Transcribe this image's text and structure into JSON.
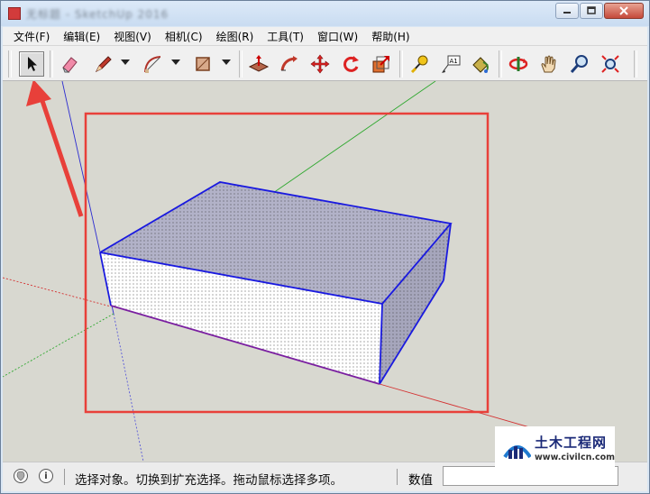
{
  "window": {
    "title_blurred": "无标题 - SketchUp 2016",
    "minimize_label": "minimize-icon",
    "maximize_label": "maximize-icon",
    "close_label": "close-icon"
  },
  "menubar": {
    "items": [
      {
        "label": "文件(F)"
      },
      {
        "label": "编辑(E)"
      },
      {
        "label": "视图(V)"
      },
      {
        "label": "相机(C)"
      },
      {
        "label": "绘图(R)"
      },
      {
        "label": "工具(T)"
      },
      {
        "label": "窗口(W)"
      },
      {
        "label": "帮助(H)"
      }
    ]
  },
  "toolbar": {
    "tools": [
      {
        "icon": "select-arrow-icon",
        "selected": true
      },
      {
        "icon": "eraser-icon"
      },
      {
        "icon": "pencil-line-icon",
        "dropdown": true
      },
      {
        "icon": "arc-icon",
        "dropdown": true
      },
      {
        "icon": "rectangle-shape-icon",
        "dropdown": true
      },
      {
        "icon": "push-pull-icon"
      },
      {
        "icon": "follow-me-icon"
      },
      {
        "icon": "move-icon"
      },
      {
        "icon": "rotate-icon"
      },
      {
        "icon": "scale-icon"
      },
      {
        "icon": "tape-measure-icon"
      },
      {
        "icon": "text-label-icon",
        "label": "A1"
      },
      {
        "icon": "paint-bucket-icon"
      },
      {
        "icon": "orbit-icon"
      },
      {
        "icon": "pan-hand-icon"
      },
      {
        "icon": "zoom-icon"
      },
      {
        "icon": "zoom-extents-icon"
      }
    ]
  },
  "statusbar": {
    "hint": "选择对象。切换到扩充选择。拖动鼠标选择多项。",
    "measure_label": "数值",
    "measure_value": ""
  },
  "watermark": {
    "title": "土木工程网",
    "url": "www.civilcn.com"
  },
  "colors": {
    "annotation_red": "#e8403a",
    "edge_blue": "#1a1adf",
    "axis_green": "#2fa82f",
    "axis_red": "#d43030",
    "face_top": "#b3b3c6",
    "face_side": "#a8a8bc",
    "face_front": "#ffffff"
  }
}
